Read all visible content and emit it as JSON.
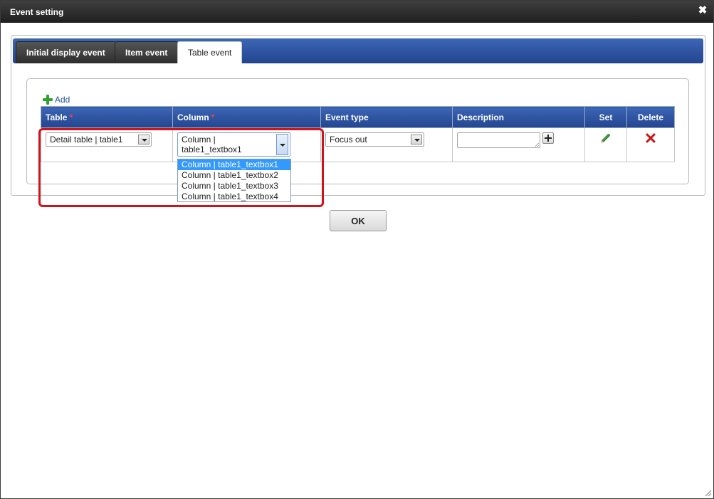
{
  "dialog": {
    "title": "Event setting",
    "close_glyph": "✖"
  },
  "tabs": [
    {
      "label": "Initial display event",
      "active": false
    },
    {
      "label": "Item event",
      "active": false
    },
    {
      "label": "Table event",
      "active": true
    }
  ],
  "add_link": {
    "label": "Add",
    "icon": "plus-icon"
  },
  "table": {
    "headers": {
      "table": "Table",
      "column": "Column",
      "event_type": "Event type",
      "description": "Description",
      "set": "Set",
      "delete": "Delete"
    },
    "required_marker": "*",
    "row": {
      "table_value": "Detail table | table1",
      "column_value": "Column | table1_textbox1",
      "event_type_value": "Focus out",
      "description_value": ""
    }
  },
  "column_dropdown": {
    "options": [
      "Column | table1_textbox1",
      "Column | table1_textbox2",
      "Column | table1_textbox3",
      "Column | table1_textbox4"
    ],
    "selected_index": 0
  },
  "ok_button": {
    "label": "OK"
  },
  "colors": {
    "header_blue": "#2b4f9c",
    "highlight_red": "#d0121b",
    "selected_option": "#3399ff",
    "add_green": "#2ea12e",
    "delete_red": "#cc1111"
  }
}
